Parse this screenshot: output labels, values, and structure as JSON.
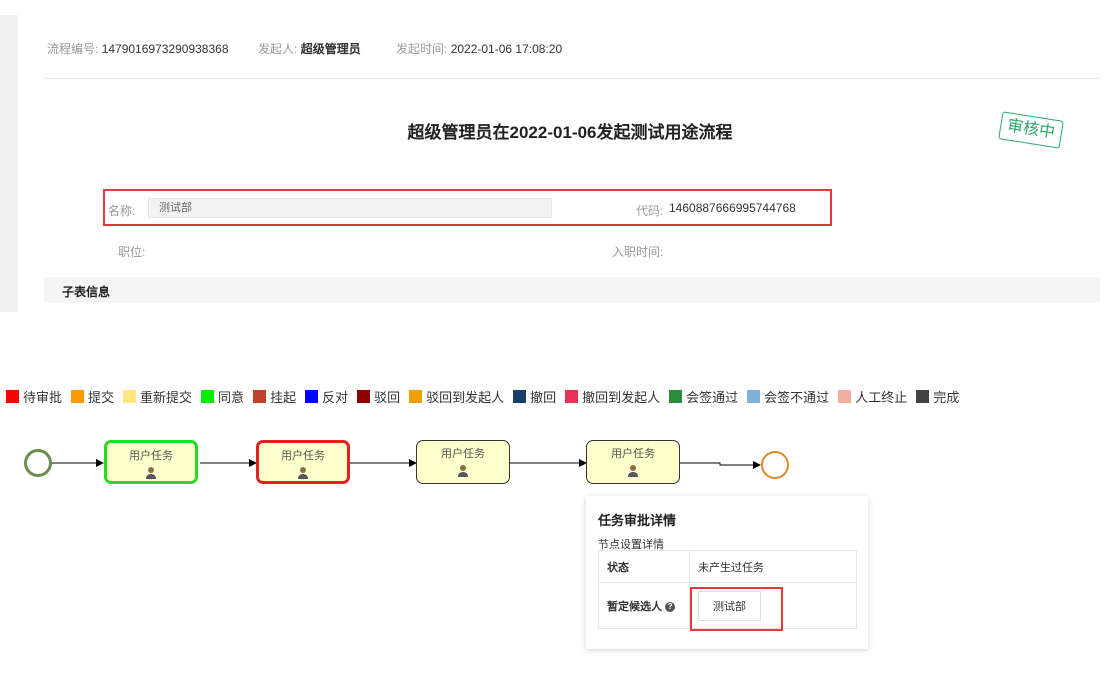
{
  "meta": {
    "process_no_label": "流程编号:",
    "process_no": "1479016973290938368",
    "initiator_label": "发起人:",
    "initiator": "超级管理员",
    "time_label": "发起时间:",
    "time": "2022-01-06 17:08:20"
  },
  "title": "超级管理员在2022-01-06发起测试用途流程",
  "stamp": "审核中",
  "form": {
    "name_label": "名称:",
    "name_value": "测试部",
    "code_label": "代码:",
    "code_value": "1460887666995744768",
    "position_label": "职位:",
    "entry_label": "入职时间:"
  },
  "sub_table_title": "子表信息",
  "legend": [
    {
      "label": "待审批",
      "color": "#ff0000"
    },
    {
      "label": "提交",
      "color": "#ff9900"
    },
    {
      "label": "重新提交",
      "color": "#ffe680"
    },
    {
      "label": "同意",
      "color": "#00ee00"
    },
    {
      "label": "挂起",
      "color": "#c0402a"
    },
    {
      "label": "反对",
      "color": "#0000ff"
    },
    {
      "label": "驳回",
      "color": "#8b0000"
    },
    {
      "label": "驳回到发起人",
      "color": "#f0a000"
    },
    {
      "label": "撤回",
      "color": "#1a3d6b"
    },
    {
      "label": "撤回到发起人",
      "color": "#e8325a"
    },
    {
      "label": "会签通过",
      "color": "#2e8b3e"
    },
    {
      "label": "会签不通过",
      "color": "#7fb2d8"
    },
    {
      "label": "人工终止",
      "color": "#f0b0a0"
    },
    {
      "label": "完成",
      "color": "#444444"
    }
  ],
  "flow": {
    "nodes": [
      {
        "label": "用户任务",
        "border": "#22dd22"
      },
      {
        "label": "用户任务",
        "border": "#e52020"
      },
      {
        "label": "用户任务",
        "border": "#333333"
      },
      {
        "label": "用户任务",
        "border": "#333333"
      }
    ],
    "start_color": "#6b8e4e",
    "end_color": "#d98a2a"
  },
  "popup": {
    "title": "任务审批详情",
    "subtitle": "节点设置详情",
    "status_label": "状态",
    "status_value": "未产生过任务",
    "candidate_label": "暂定候选人",
    "candidate_value": "测试部"
  }
}
